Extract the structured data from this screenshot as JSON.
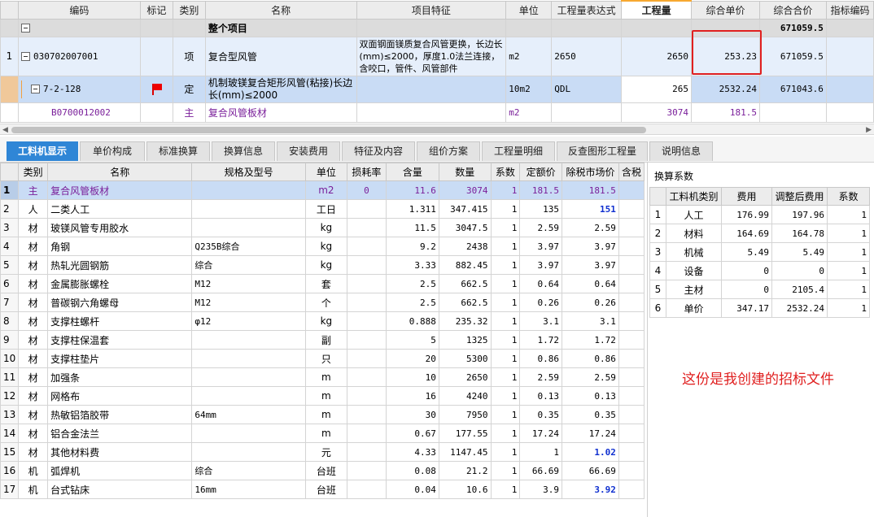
{
  "top_grid": {
    "headers": [
      "编码",
      "标记",
      "类别",
      "名称",
      "项目特征",
      "单位",
      "工程量表达式",
      "工程量",
      "综合单价",
      "综合合价",
      "指标编码"
    ],
    "total_row": {
      "name": "整个项目",
      "total_price": "671059.5"
    },
    "item_row": {
      "index": "1",
      "code": "030702007001",
      "category": "项",
      "name": "复合型风管",
      "feature": "双面钢面镁质复合风管更换，长边长(mm)≤2000，厚度1.0法兰连接，含咬口，管件、风管部件",
      "unit": "m2",
      "expr": "2650",
      "quantity": "2650",
      "unit_price": "253.23",
      "total_price": "671059.5"
    },
    "quota_row": {
      "code": "7-2-128",
      "category": "定",
      "name": "机制玻镁复合矩形风管(粘接)长边长(mm)≤2000",
      "unit": "10m2",
      "expr": "QDL",
      "quantity": "265",
      "unit_price": "2532.24",
      "total_price": "671043.6"
    },
    "main_row": {
      "code": "B0700012002",
      "category": "主",
      "name": "复合风管板材",
      "unit": "m2",
      "quantity": "3074",
      "unit_price": "181.5"
    }
  },
  "tabs": [
    "工料机显示",
    "单价构成",
    "标准换算",
    "换算信息",
    "安装费用",
    "特征及内容",
    "组价方案",
    "工程量明细",
    "反查图形工程量",
    "说明信息"
  ],
  "bottom_grid": {
    "headers": [
      "类别",
      "名称",
      "规格及型号",
      "单位",
      "损耗率",
      "含量",
      "数量",
      "系数",
      "定额价",
      "除税市场价",
      "含税"
    ],
    "rows": [
      {
        "idx": "1",
        "cat": "主",
        "name": "复合风管板材",
        "spec": "",
        "unit": "m2",
        "loss": "0",
        "content": "11.6",
        "qty": "3074",
        "coef": "1",
        "quota_price": "181.5",
        "market_price": "181.5"
      },
      {
        "idx": "2",
        "cat": "人",
        "name": "二类人工",
        "spec": "",
        "unit": "工日",
        "loss": "",
        "content": "1.311",
        "qty": "347.415",
        "coef": "1",
        "quota_price": "135",
        "market_price": "151"
      },
      {
        "idx": "3",
        "cat": "材",
        "name": "玻镁风管专用胶水",
        "spec": "",
        "unit": "kg",
        "loss": "",
        "content": "11.5",
        "qty": "3047.5",
        "coef": "1",
        "quota_price": "2.59",
        "market_price": "2.59"
      },
      {
        "idx": "4",
        "cat": "材",
        "name": "角钢",
        "spec": "Q235B综合",
        "unit": "kg",
        "loss": "",
        "content": "9.2",
        "qty": "2438",
        "coef": "1",
        "quota_price": "3.97",
        "market_price": "3.97"
      },
      {
        "idx": "5",
        "cat": "材",
        "name": "热轧光圆钢筋",
        "spec": "综合",
        "unit": "kg",
        "loss": "",
        "content": "3.33",
        "qty": "882.45",
        "coef": "1",
        "quota_price": "3.97",
        "market_price": "3.97"
      },
      {
        "idx": "6",
        "cat": "材",
        "name": "金属膨胀螺栓",
        "spec": "M12",
        "unit": "套",
        "loss": "",
        "content": "2.5",
        "qty": "662.5",
        "coef": "1",
        "quota_price": "0.64",
        "market_price": "0.64"
      },
      {
        "idx": "7",
        "cat": "材",
        "name": "普碳钢六角螺母",
        "spec": "M12",
        "unit": "个",
        "loss": "",
        "content": "2.5",
        "qty": "662.5",
        "coef": "1",
        "quota_price": "0.26",
        "market_price": "0.26"
      },
      {
        "idx": "8",
        "cat": "材",
        "name": "支撑柱螺杆",
        "spec": "φ12",
        "unit": "kg",
        "loss": "",
        "content": "0.888",
        "qty": "235.32",
        "coef": "1",
        "quota_price": "3.1",
        "market_price": "3.1"
      },
      {
        "idx": "9",
        "cat": "材",
        "name": "支撑柱保温套",
        "spec": "",
        "unit": "副",
        "loss": "",
        "content": "5",
        "qty": "1325",
        "coef": "1",
        "quota_price": "1.72",
        "market_price": "1.72"
      },
      {
        "idx": "10",
        "cat": "材",
        "name": "支撑柱垫片",
        "spec": "",
        "unit": "只",
        "loss": "",
        "content": "20",
        "qty": "5300",
        "coef": "1",
        "quota_price": "0.86",
        "market_price": "0.86"
      },
      {
        "idx": "11",
        "cat": "材",
        "name": "加强条",
        "spec": "",
        "unit": "m",
        "loss": "",
        "content": "10",
        "qty": "2650",
        "coef": "1",
        "quota_price": "2.59",
        "market_price": "2.59"
      },
      {
        "idx": "12",
        "cat": "材",
        "name": "网格布",
        "spec": "",
        "unit": "m",
        "loss": "",
        "content": "16",
        "qty": "4240",
        "coef": "1",
        "quota_price": "0.13",
        "market_price": "0.13"
      },
      {
        "idx": "13",
        "cat": "材",
        "name": "热敏铝箔胶带",
        "spec": "64mm",
        "unit": "m",
        "loss": "",
        "content": "30",
        "qty": "7950",
        "coef": "1",
        "quota_price": "0.35",
        "market_price": "0.35"
      },
      {
        "idx": "14",
        "cat": "材",
        "name": "铝合金法兰",
        "spec": "",
        "unit": "m",
        "loss": "",
        "content": "0.67",
        "qty": "177.55",
        "coef": "1",
        "quota_price": "17.24",
        "market_price": "17.24"
      },
      {
        "idx": "15",
        "cat": "材",
        "name": "其他材料费",
        "spec": "",
        "unit": "元",
        "loss": "",
        "content": "4.33",
        "qty": "1147.45",
        "coef": "1",
        "quota_price": "1",
        "market_price": "1.02"
      },
      {
        "idx": "16",
        "cat": "机",
        "name": "弧焊机",
        "spec": "综合",
        "unit": "台班",
        "loss": "",
        "content": "0.08",
        "qty": "21.2",
        "coef": "1",
        "quota_price": "66.69",
        "market_price": "66.69"
      },
      {
        "idx": "17",
        "cat": "机",
        "name": "台式钻床",
        "spec": "16mm",
        "unit": "台班",
        "loss": "",
        "content": "0.04",
        "qty": "10.6",
        "coef": "1",
        "quota_price": "3.9",
        "market_price": "3.92"
      }
    ]
  },
  "right_panel": {
    "title": "换算系数",
    "headers": [
      "工料机类别",
      "费用",
      "调整后费用",
      "系数"
    ],
    "rows": [
      {
        "idx": "1",
        "cat": "人工",
        "fee": "176.99",
        "adj": "197.96",
        "coef": "1"
      },
      {
        "idx": "2",
        "cat": "材料",
        "fee": "164.69",
        "adj": "164.78",
        "coef": "1"
      },
      {
        "idx": "3",
        "cat": "机械",
        "fee": "5.49",
        "adj": "5.49",
        "coef": "1"
      },
      {
        "idx": "4",
        "cat": "设备",
        "fee": "0",
        "adj": "0",
        "coef": "1"
      },
      {
        "idx": "5",
        "cat": "主材",
        "fee": "0",
        "adj": "2105.4",
        "coef": "1"
      },
      {
        "idx": "6",
        "cat": "单价",
        "fee": "347.17",
        "adj": "2532.24",
        "coef": "1"
      }
    ]
  },
  "annotation": "这份是我创建的招标文件",
  "colors": {
    "accent": "#2f86d6",
    "highlight_red": "#e02020",
    "main_material": "#7a1f9a",
    "adjusted_blue": "#1030d0"
  }
}
